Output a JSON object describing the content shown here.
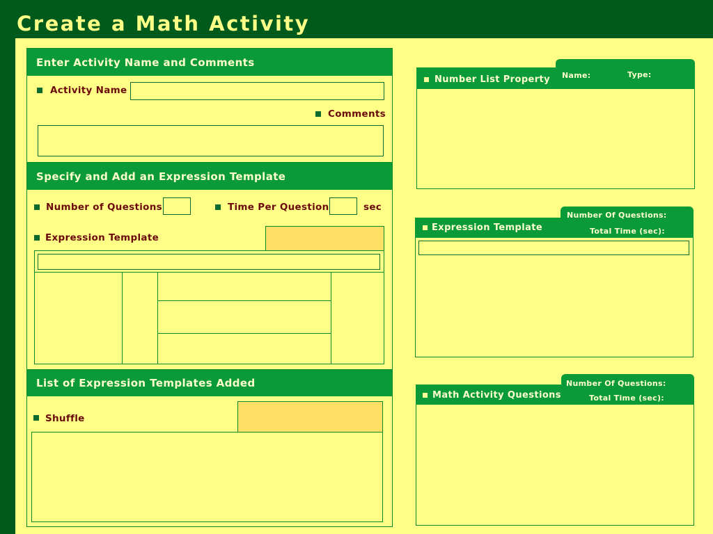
{
  "app": {
    "title": "Create a Math Activity"
  },
  "activity": {
    "header": "Enter Activity Name and Comments",
    "name_label": "Activity Name",
    "name_value": "",
    "comments_label": "Comments",
    "comments_value": ""
  },
  "expression": {
    "header": "Specify and Add an Expression Template",
    "num_questions_label": "Number of Questions",
    "time_per_question_label": "Time Per Question",
    "sec_label": "sec",
    "template_label": "Expression Template"
  },
  "templates_list": {
    "header": "List of Expression Templates Added",
    "shuffle_label": "Shuffle"
  },
  "number_list_panel": {
    "title": "Number List Property",
    "name_label": "Name:",
    "type_label": "Type:"
  },
  "expression_panel": {
    "title": "Expression Template",
    "num_questions_label": "Number Of Questions:",
    "total_time_label": "Total Time (sec):"
  },
  "questions_panel": {
    "title": "Math Activity Questions",
    "num_questions_label": "Number Of Questions:",
    "total_time_label": "Total Time (sec):"
  },
  "colors": {
    "background": "#ffff88",
    "dark_green": "#005a1c",
    "header_green": "#0b9a38",
    "label_maroon": "#6b0a0a",
    "accent_orange": "#ffdf66"
  }
}
